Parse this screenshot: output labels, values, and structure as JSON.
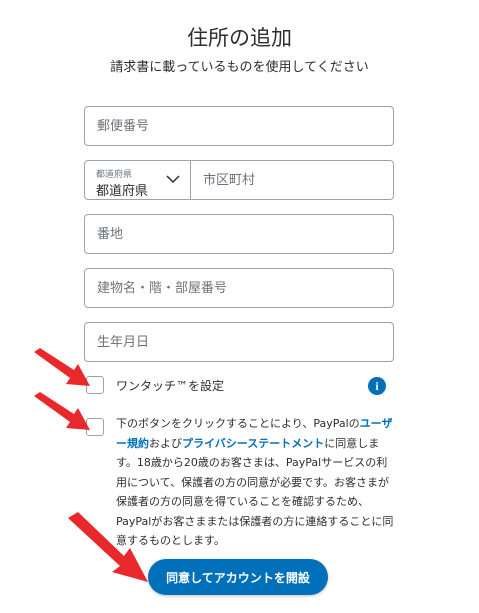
{
  "header": {
    "title": "住所の追加",
    "subtitle": "請求書に載っているものを使用してください"
  },
  "form": {
    "postal_code": {
      "placeholder": "郵便番号",
      "value": ""
    },
    "prefecture": {
      "label": "都道府県",
      "value": "都道府県"
    },
    "city": {
      "placeholder": "市区町村",
      "value": ""
    },
    "street": {
      "placeholder": "番地",
      "value": ""
    },
    "building": {
      "placeholder": "建物名・階・部屋番号",
      "value": ""
    },
    "birthdate": {
      "placeholder": "生年月日",
      "value": ""
    }
  },
  "one_touch": {
    "label": "ワンタッチ™を設定",
    "checked": false,
    "info_icon": "info-icon",
    "info_glyph": "i"
  },
  "consent": {
    "checked": false,
    "text_1": "下のボタンをクリックすることにより、PayPalの",
    "link_terms": "ユーザー規約",
    "text_2": "および",
    "link_privacy": "プライバシーステートメント",
    "text_3": "に同意します。18歳から20歳のお客さまは、PayPalサービスの利用について、保護者の方の同意が必要です。お客さまが保護者の方の同意を得ていることを確認するため、PayPalがお客さままたは保護者の方に連絡することに同意するものとします。"
  },
  "submit_button": {
    "label": "同意してアカウントを開設"
  },
  "colors": {
    "accent": "#0070ba",
    "annotation_arrow": "#e8282b",
    "border": "#9da3a6"
  }
}
